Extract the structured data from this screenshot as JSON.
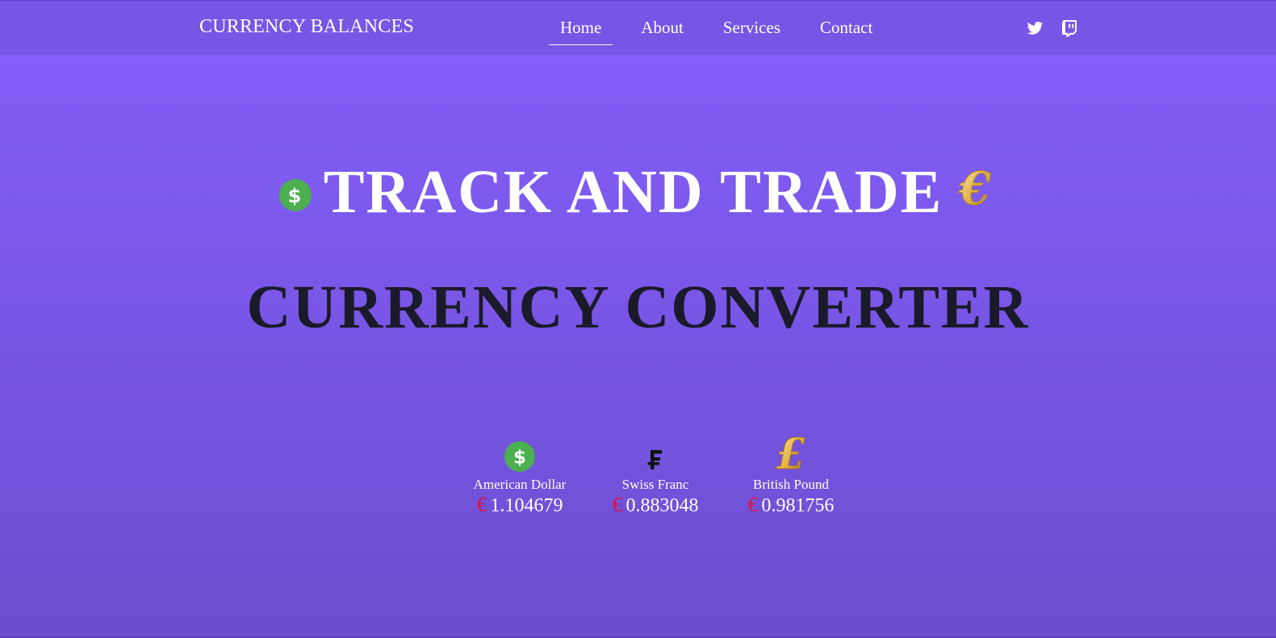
{
  "header": {
    "brand": "CURRENCY BALANCES",
    "nav": [
      {
        "label": "Home",
        "active": true
      },
      {
        "label": "About",
        "active": false
      },
      {
        "label": "Services",
        "active": false
      },
      {
        "label": "Contact",
        "active": false
      }
    ],
    "social": [
      "twitter-icon",
      "twitch-icon"
    ]
  },
  "hero": {
    "line1": "TRACK AND TRADE",
    "line2": "CURRENCY CONVERTER",
    "left_icon": "dollar-coin-icon",
    "right_icon": "euro-gold-icon"
  },
  "rates": [
    {
      "icon": "dollar-coin-icon",
      "name": "American Dollar",
      "symbol": "€",
      "value": "1.104679"
    },
    {
      "icon": "franc-icon",
      "name": "Swiss Franc",
      "symbol": "€",
      "value": "0.883048"
    },
    {
      "icon": "pound-gold-icon",
      "name": "British Pound",
      "symbol": "€",
      "value": "0.981756"
    }
  ],
  "colors": {
    "background_top": "#8560fb",
    "background_bottom": "#6c4ecf",
    "header_bg": "#7756e6",
    "hero_light": "#ffffff",
    "hero_dark": "#1b1a2a",
    "euro_red": "#e1123a",
    "coin_green": "#4caf50",
    "gold": "#d9a93a"
  }
}
